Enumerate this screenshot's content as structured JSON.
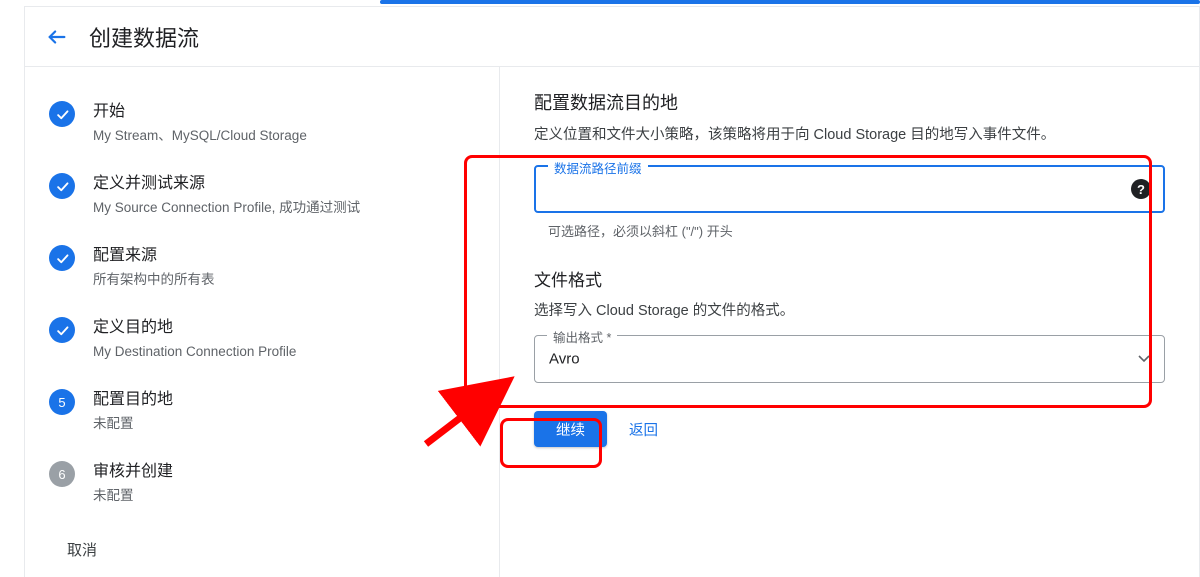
{
  "header": {
    "title": "创建数据流"
  },
  "steps": [
    {
      "title": "开始",
      "sub": "My Stream、MySQL/Cloud Storage"
    },
    {
      "title": "定义并测试来源",
      "sub": "My Source Connection Profile, 成功通过测试"
    },
    {
      "title": "配置来源",
      "sub": "所有架构中的所有表"
    },
    {
      "title": "定义目的地",
      "sub": "My Destination Connection Profile"
    },
    {
      "num": "5",
      "title": "配置目的地",
      "sub": "未配置"
    },
    {
      "num": "6",
      "title": "审核并创建",
      "sub": "未配置"
    }
  ],
  "left": {
    "cancel": "取消"
  },
  "form": {
    "heading": "配置数据流目的地",
    "desc": "定义位置和文件大小策略，该策略将用于向 Cloud Storage 目的地写入事件文件。",
    "path_prefix": {
      "label": "数据流路径前缀",
      "value": "",
      "helper": "可选路径，必须以斜杠 (\"/\") 开头"
    },
    "file_format": {
      "heading": "文件格式",
      "desc": "选择写入 Cloud Storage 的文件的格式。",
      "select_label": "输出格式 *",
      "selected": "Avro"
    },
    "buttons": {
      "continue": "继续",
      "back": "返回"
    }
  },
  "colors": {
    "primary": "#1a73e8",
    "annotation": "#ff0000",
    "text_secondary": "#5f6368"
  }
}
